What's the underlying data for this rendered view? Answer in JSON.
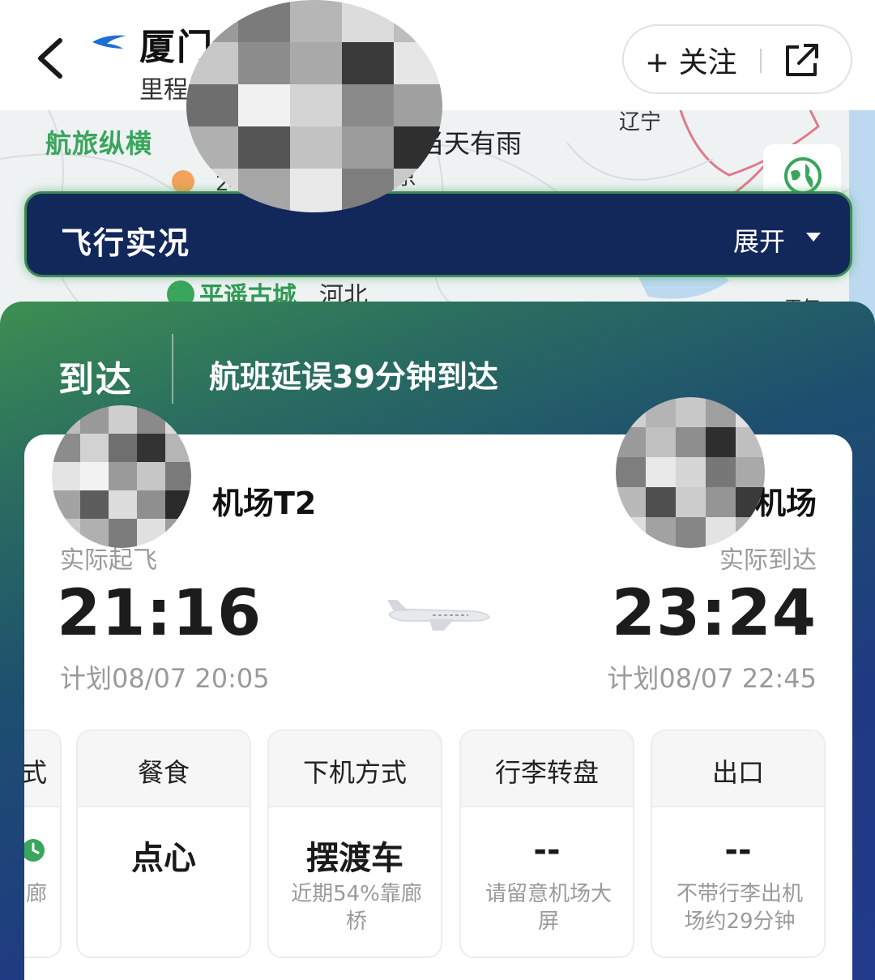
{
  "header": {
    "title": "厦门",
    "subtitle": "里程",
    "follow_label": "+ 关注"
  },
  "map": {
    "brand": "航旅纵横",
    "weather_text": "当天有雨",
    "labels": [
      "辽宁",
      "河北",
      "24",
      "京"
    ],
    "poi": "平遥古城",
    "side_label": "天气"
  },
  "live_bar": {
    "title": "飞行实况",
    "expand_label": "展开"
  },
  "status": {
    "label": "到达",
    "message": "航班延误39分钟到达"
  },
  "departure": {
    "airport": "机场T2",
    "label": "实际起飞",
    "time": "21:16",
    "scheduled": "计划08/07 20:05"
  },
  "arrival": {
    "airport": "机场",
    "label": "实际到达",
    "time": "23:24",
    "scheduled": "计划08/07 22:45"
  },
  "tiles": [
    {
      "title": "式",
      "value": "",
      "note": "廊"
    },
    {
      "title": "餐食",
      "value": "点心",
      "note": ""
    },
    {
      "title": "下机方式",
      "value": "摆渡车",
      "note": "近期54%靠廊桥"
    },
    {
      "title": "行李转盘",
      "value": "--",
      "note": "请留意机场大屏"
    },
    {
      "title": "出口",
      "value": "--",
      "note": "不带行李出机场约29分钟"
    }
  ],
  "colors": {
    "brand_green": "#3aa55c",
    "live_bar_bg": "#12275a",
    "panel_top": "#3d8f52",
    "panel_bottom": "#213a8c"
  },
  "icons": [
    "back-arrow-icon",
    "airline-logo-icon",
    "share-icon",
    "globe-icon",
    "location-pin-icon",
    "caret-down-icon",
    "plane-icon",
    "clock-icon"
  ]
}
